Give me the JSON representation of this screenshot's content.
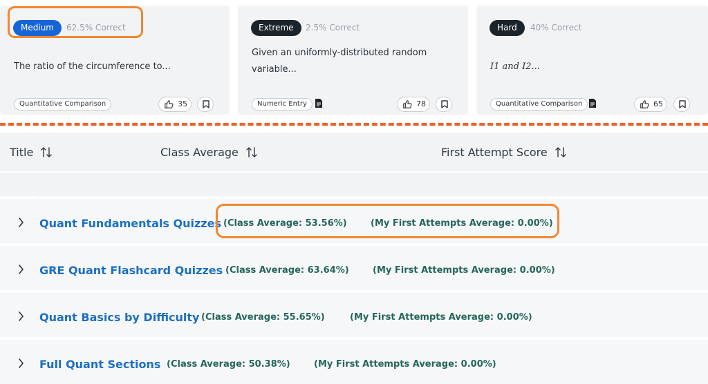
{
  "cards": [
    {
      "difficulty": "Medium",
      "difficulty_color": "#1565d8",
      "correct": "62.5% Correct",
      "question": "The ratio of the circumference to...",
      "tag": "Quantitative Comparison",
      "likes": "35",
      "has_doc_icon": false
    },
    {
      "difficulty": "Extreme",
      "difficulty_color": "#1b232b",
      "correct": "2.5% Correct",
      "question": "Given an uniformly-distributed random variable...",
      "question_line1": "Given an uniformly-distributed random",
      "question_line2": "variable...",
      "tag": "Numeric Entry",
      "likes": "78",
      "has_doc_icon": true
    },
    {
      "difficulty": "Hard",
      "difficulty_color": "#1b232b",
      "correct": "40% Correct",
      "question": "I1 and I2...",
      "tag": "Quantitative Comparison",
      "likes": "65",
      "has_doc_icon": true
    }
  ],
  "table": {
    "columns": [
      "Title",
      "Class Average",
      "First Attempt Score"
    ]
  },
  "groups": [
    {
      "title": "Quant Fundamentals Quizzes",
      "class_avg": "(Class Average: 53.56%)",
      "first_attempts": "(My First Attempts Average: 0.00%)"
    },
    {
      "title": "GRE Quant Flashcard Quizzes",
      "class_avg": "(Class Average: 63.64%)",
      "first_attempts": "(My First Attempts Average: 0.00%)"
    },
    {
      "title": "Quant Basics by Difficulty",
      "class_avg": "(Class Average: 55.65%)",
      "first_attempts": "(My First Attempts Average: 0.00%)"
    },
    {
      "title": "Full Quant Sections",
      "class_avg": "(Class Average: 50.38%)",
      "first_attempts": "(My First Attempts Average: 0.00%)"
    }
  ],
  "colors": {
    "highlight": "#f2862f",
    "divider": "#ec6428",
    "group_title": "#1b6fc2",
    "stat_text": "#25665c"
  }
}
